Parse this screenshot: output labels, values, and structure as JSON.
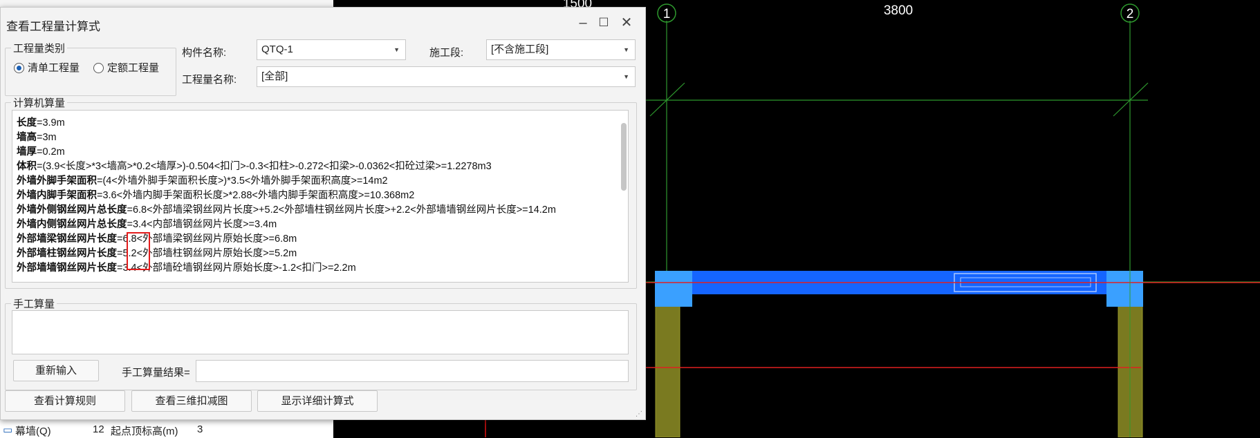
{
  "dialog": {
    "title": "查看工程量计算式",
    "quantity_type_group": "工程量类别",
    "radio_list": "清单工程量",
    "radio_quota": "定额工程量",
    "component_name_label": "构件名称:",
    "component_name_value": "QTQ-1",
    "stage_label": "施工段:",
    "stage_value": "[不含施工段]",
    "quantity_name_label": "工程量名称:",
    "quantity_name_value": "[全部]",
    "computer_group": "计算机算量",
    "calc_lines": [
      {
        "name": "长度",
        "expr": "=3.9m"
      },
      {
        "name": "墙高",
        "expr": "=3m"
      },
      {
        "name": "墙厚",
        "expr": "=0.2m"
      },
      {
        "name": "体积",
        "expr": "=(3.9<长度>*3<墙高>*0.2<墙厚>)-0.504<扣门>-0.3<扣柱>-0.272<扣梁>-0.0362<扣砼过梁>=1.2278m3"
      },
      {
        "name": "外墙外脚手架面积",
        "expr": "=(4<外墙外脚手架面积长度>)*3.5<外墙外脚手架面积高度>=14m2"
      },
      {
        "name": "外墙内脚手架面积",
        "expr": "=3.6<外墙内脚手架面积长度>*2.88<外墙内脚手架面积高度>=10.368m2"
      },
      {
        "name": "外墙外侧钢丝网片总长度",
        "expr": "=6.8<外部墙梁钢丝网片长度>+5.2<外部墙柱钢丝网片长度>+2.2<外部墙墙钢丝网片长度>=14.2m"
      },
      {
        "name": "外墙内侧钢丝网片总长度",
        "expr": "=3.4<内部墙钢丝网片长度>=3.4m"
      },
      {
        "name": "外部墙梁钢丝网片长度",
        "expr": "=6.8<外部墙梁钢丝网片原始长度>=6.8m"
      },
      {
        "name": "外部墙柱钢丝网片长度",
        "expr": "=5.2<外部墙柱钢丝网片原始长度>=5.2m"
      },
      {
        "name": "外部墙墙钢丝网片长度",
        "expr": "=3.4<外部墙砼墙钢丝网片原始长度>-1.2<扣门>=2.2m"
      }
    ],
    "manual_group": "手工算量",
    "reinput_button": "重新输入",
    "manual_result_label": "手工算量结果=",
    "view_rules_button": "查看计算规则",
    "view_3d_button": "查看三维扣减图",
    "show_detail_button": "显示详细计算式"
  },
  "cad": {
    "axis_1": "1",
    "axis_2": "2",
    "dimension": "3800",
    "top_partial": "1500"
  },
  "property_row": {
    "left_item": "幕墙(Q)",
    "row_no": "12",
    "prop_name": "起点顶标高(m)",
    "prop_value": "3"
  }
}
